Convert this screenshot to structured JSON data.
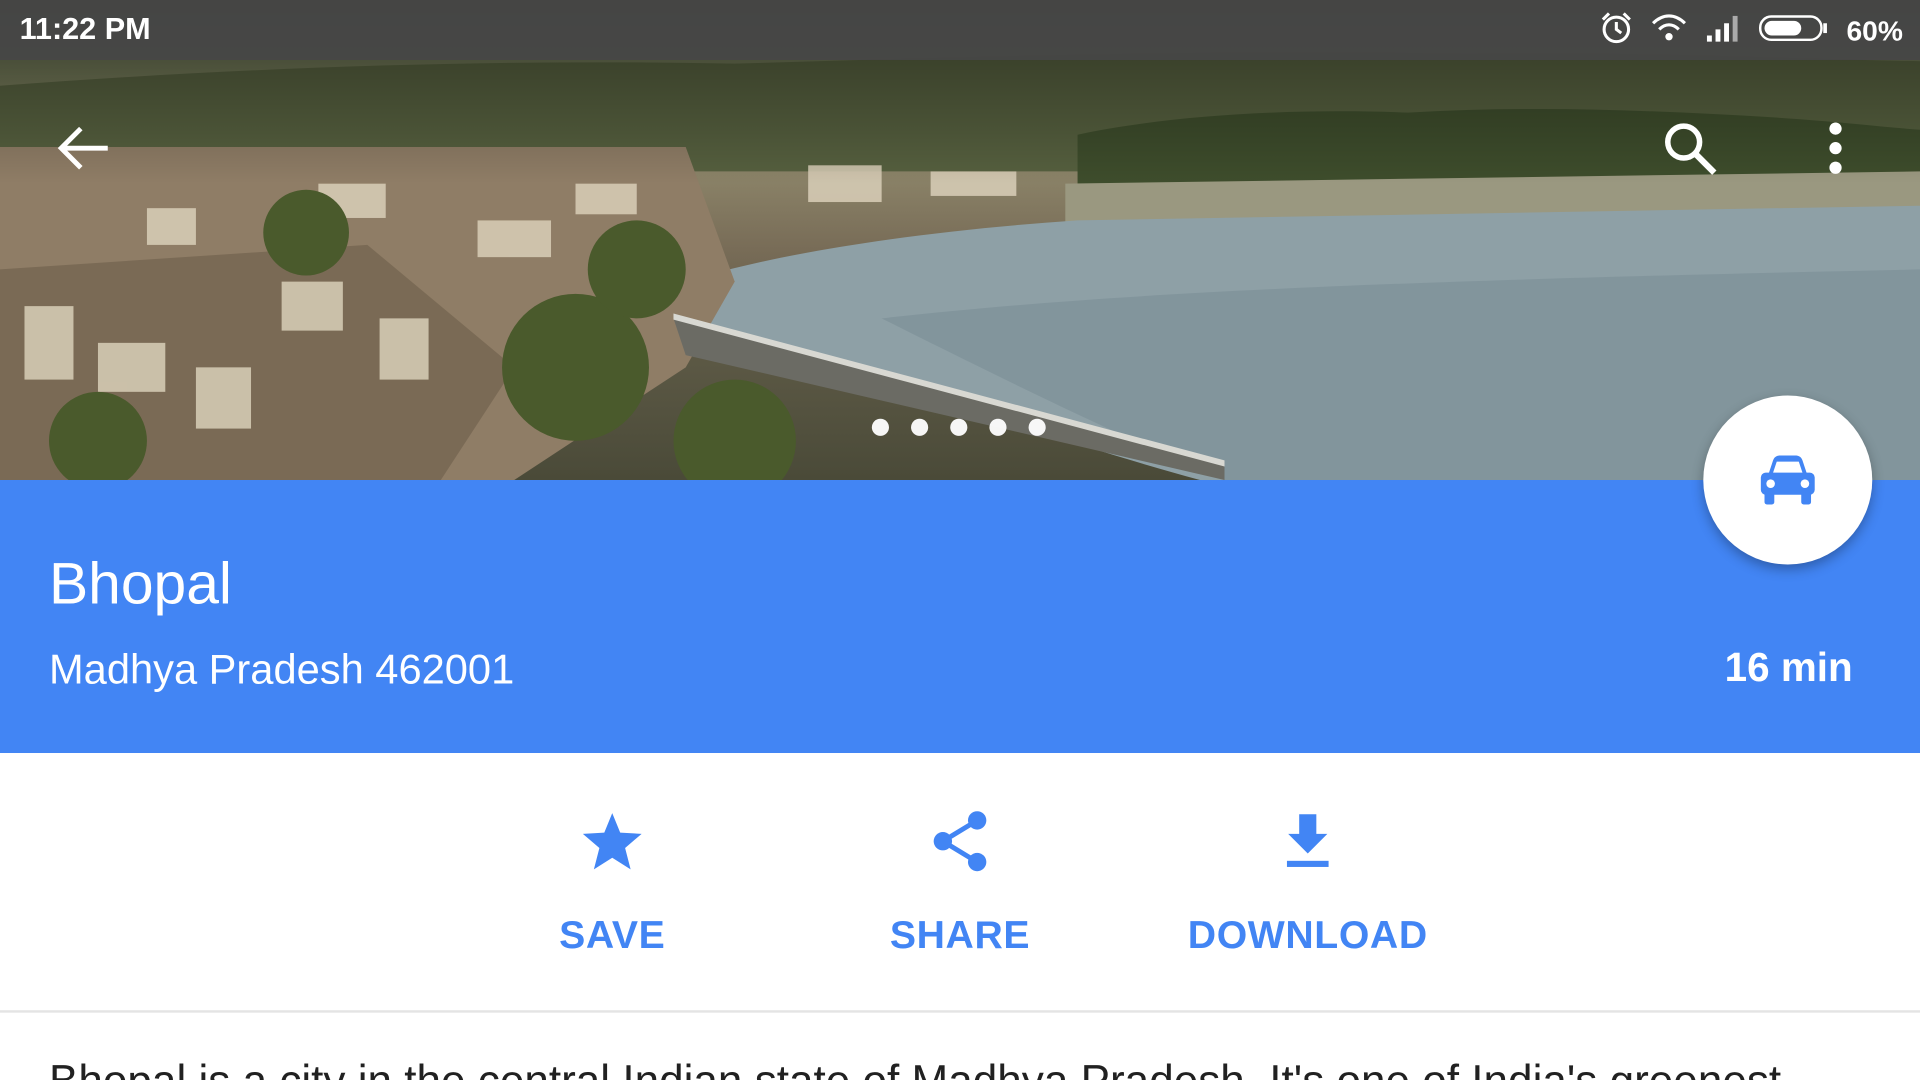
{
  "status_bar": {
    "time": "11:22 PM",
    "battery_percent": "60%",
    "icons": [
      "alarm-icon",
      "wifi-icon",
      "signal-icon",
      "battery-icon"
    ]
  },
  "toolbar": {
    "icons": [
      "back-arrow-icon",
      "search-icon",
      "more-vert-icon"
    ]
  },
  "photo_pager": {
    "page_count": 5,
    "current_index": 0
  },
  "place": {
    "name": "Bhopal",
    "address": "Madhya Pradesh 462001",
    "travel_time": "16 min",
    "travel_mode_icon": "car-icon"
  },
  "actions": [
    {
      "label": "SAVE",
      "icon": "star-icon"
    },
    {
      "label": "SHARE",
      "icon": "share-icon"
    },
    {
      "label": "DOWNLOAD",
      "icon": "download-icon"
    }
  ],
  "description": "Bhopal is a city in the central Indian state of Madhya Pradesh. It's one of India's greenest",
  "colors": {
    "accent": "#4285f4",
    "status_bar": "#464646",
    "text_primary": "#212121"
  }
}
